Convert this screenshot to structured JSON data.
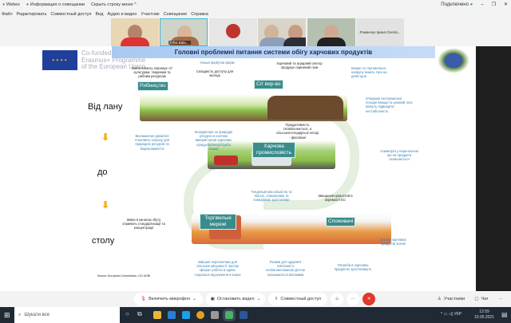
{
  "titlebar": {
    "app": "Webex",
    "info": "Информация о совещании",
    "hide_menu": "Скрыть строку меню ^",
    "status": "Подключено",
    "minimize": "–",
    "restore": "❐",
    "close": "✕"
  },
  "menu": [
    "Файл",
    "Редактировать",
    "Совместный доступ",
    "Вид",
    "Аудио и видео",
    "Участник",
    "Совещание",
    "Справка"
  ],
  "participants": {
    "tile2_name": "Olha Bala...",
    "tile6_name": "Романчук Ірина Олегів..."
  },
  "slide": {
    "title": "Головні проблемні питання системи обігу харчових продуктів",
    "eu_text": [
      "Co-funded by the",
      "Erasmus+ Programme",
      "of the European Union"
    ],
    "stages": {
      "from": "Від лану",
      "to": "до",
      "table": "столу"
    },
    "tags": {
      "fishing": "Рибництво",
      "agri": "С/г вир-во",
      "food_industry": "Харчова промисловість",
      "retail": "Торгівельні мережі",
      "consumers": "Споживачі"
    },
    "notes": {
      "n1": "Зміна клімату загрожує с/г культурам, тваринам та рибним ресурсам",
      "n2": "Низькі прибутки ферм;",
      "n3": "Складність доступу для молоді",
      "n4": "Харчовий та аграрний сектор продукує парникові гази",
      "n5": "Макро та торговельна напруга чинить тиск на деякі ціни",
      "n6": "Очікувані екстремальні погодні явища та ціновий тиск можуть підвищити нестабільність",
      "n7": "Виснаження довкілля становить загрозу для природніх ресурсів та біорізноманіття",
      "n8": "Конкуренція за природні ресурси в системі використання харчових продуктів/енергії/урба нізації",
      "n9": "Продуктивність сповільнюється, а сільськогосподарські площі - фіксовані",
      "n10": "Асиметрія у переносенні цін на продукти залишається",
      "n11": "Тенденція між кількістю та якістю, ставленням та поведінкою зростатиме",
      "n12": "Звищення цінностей в окремості ЄС",
      "n13": "Зміни в каналах збуту сприяють стандартизації та концентрації",
      "n14": "Змішані перспективи для сільської місцевості частіші пріорит роботи в однім, соціальне відчуження в інших",
      "n15": "Ризики для здоров'я пов'язані із незбалансованою дієтою залишаються високими",
      "n16": "Потреби в харчових продуктах зростатимуть",
      "n17": "Втрати харчових продуктів значні"
    },
    "source": "Source: European Commission, DG AGRI"
  },
  "toolbar": {
    "mic": "Включить микрофон",
    "video": "Остановить видео",
    "share": "Совместный доступ",
    "participants": "Участники",
    "chat": "Чат",
    "more": "···"
  },
  "taskbar": {
    "search": "Шукати все",
    "lang": "УКР",
    "time": "12:59",
    "date": "10.05.2021"
  },
  "colors": {
    "tag": "#3a8c8c",
    "title_banner": "#a9c9f2",
    "end_call": "#e0392b",
    "arrow": "#f2b21c"
  }
}
